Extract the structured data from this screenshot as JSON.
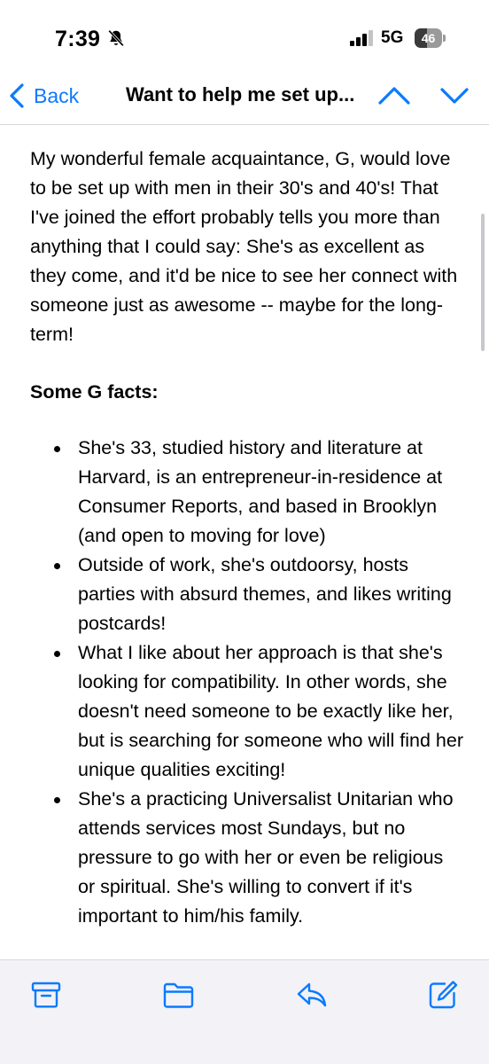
{
  "status_bar": {
    "time": "7:39",
    "network": "5G",
    "battery_level": "46",
    "battery_fraction": 0.46,
    "icons": [
      "bell-slash-icon",
      "signal-bars-icon",
      "battery-icon"
    ]
  },
  "nav": {
    "back_label": "Back",
    "title": "Want to help me set up...",
    "icons": [
      "chevron-left-icon",
      "chevron-up-icon",
      "chevron-down-icon"
    ]
  },
  "message": {
    "intro": "My wonderful female acquaintance, G, would love to be set up with men in their 30's and 40's! That I've joined the effort probably tells you more than anything that I could say: She's as excellent as they come, and it'd be nice to see her connect with someone just as awesome -- maybe for the long-term!",
    "facts_heading": "Some G facts:",
    "facts": [
      "She's 33, studied history and literature at Harvard, is an entrepreneur-in-residence at Consumer Reports, and based in Brooklyn (and open to moving for love)",
      "Outside of work, she's outdoorsy, hosts parties with absurd themes, and likes writing postcards!",
      "What I like about her approach is that she's looking for compatibility. In other words, she doesn't need someone to be exactly like her, but is searching for someone who will find her unique qualities exciting!",
      "She's a practicing Universalist Unitarian who attends services most Sundays, but no pressure to go with her or even be religious or spiritual. She's willing to convert if it's important to him/his family."
    ]
  },
  "toolbar": {
    "icons": [
      "archive-icon",
      "folder-icon",
      "reply-icon",
      "compose-icon"
    ]
  },
  "colors": {
    "accent": "#0a7aff",
    "toolbar_bg": "#f2f2f7",
    "text": "#000000"
  }
}
